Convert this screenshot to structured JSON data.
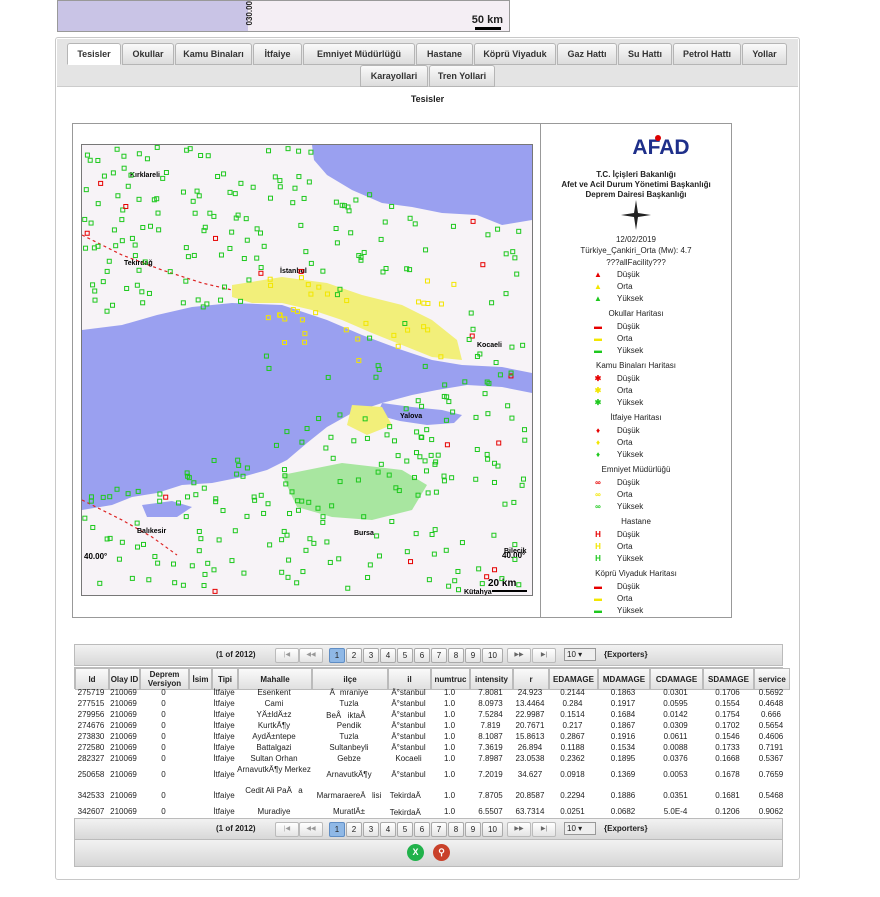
{
  "top_map": {
    "scale_label": "50 km",
    "side_label": "030.00"
  },
  "tabs": [
    {
      "label": "Tesisler"
    },
    {
      "label": "Okullar"
    },
    {
      "label": "Kamu Binaları"
    },
    {
      "label": "İtfaiye"
    },
    {
      "label": "Emniyet Müdürlüğü"
    },
    {
      "label": "Hastane"
    },
    {
      "label": "Köprü Viyaduk"
    },
    {
      "label": "Gaz Hattı"
    },
    {
      "label": "Su Hattı"
    },
    {
      "label": "Petrol Hattı"
    },
    {
      "label": "Yollar"
    },
    {
      "label": "Karayollari"
    },
    {
      "label": "Tren Yollari"
    }
  ],
  "section_title": "Tesisler",
  "map": {
    "city_labels": [
      "Kırklareli",
      "Tekirdağ",
      "İstanbul",
      "Kocaeli",
      "Yalova",
      "Balıkesir",
      "Bursa",
      "Bilecik",
      "Kütahya"
    ],
    "coord_label": "40.00°",
    "coord_label_right": "40.00°",
    "scale_label": "20 km"
  },
  "legend": {
    "logo": "AFAD",
    "org1": "T.C. İçişleri Bakanlığı",
    "org2": "Afet ve Acil Durum Yönetimi Başkanlığı",
    "org3": "Deprem Dairesi Başkanlığı",
    "date": "12/02/2019",
    "event": "Türkiye_Çankiri_Orta (Mw): 4.7",
    "subtitle": "???allFacility???",
    "groups": [
      {
        "title": "",
        "items": [
          "Düşük",
          "Orta",
          "Yüksek"
        ]
      },
      {
        "title": "Okullar Haritası",
        "items": [
          "Düşük",
          "Orta",
          "Yüksek"
        ]
      },
      {
        "title": "Kamu Binaları Haritası",
        "items": [
          "Düşük",
          "Orta",
          "Yüksek"
        ]
      },
      {
        "title": "İtfaiye Haritası",
        "items": [
          "Düşük",
          "Orta",
          "Yüksek"
        ]
      },
      {
        "title": "Emniyet Müdürlüğü",
        "items": [
          "Düşük",
          "Orta",
          "Yüksek"
        ]
      },
      {
        "title": "Hastane",
        "items": [
          "Düşük",
          "Orta",
          "Yüksek"
        ]
      },
      {
        "title": "Köprü Viyaduk Haritası",
        "items": [
          "Düşük",
          "Orta",
          "Yüksek"
        ]
      }
    ],
    "colors": {
      "low": "#e60000",
      "mid": "#f2e600",
      "high": "#1ec81e"
    }
  },
  "paginator": {
    "label": "(1 of 2012)",
    "pages": [
      "1",
      "2",
      "3",
      "4",
      "5",
      "6",
      "7",
      "8",
      "9",
      "10"
    ],
    "current": "1",
    "rows_per_page": "10",
    "exporters": "{Exporters}"
  },
  "table": {
    "columns": [
      "Id",
      "Olay ID",
      "Deprem Versiyon",
      "İsim",
      "Tipi",
      "Mahalle",
      "ilçe",
      "il",
      "numtruc",
      "intensity",
      "r",
      "EDAMAGE",
      "MDAMAGE",
      "CDAMAGE",
      "SDAMAGE",
      "service"
    ],
    "rows": [
      [
        "275719",
        "210069",
        "0",
        "",
        "İtfaiye",
        "Esenkent",
        "Ãmraniye",
        "Ä°stanbul",
        "1.0",
        "7.8081",
        "24.923",
        "0.2144",
        "0.1863",
        "0.0301",
        "0.1706",
        "0.5692"
      ],
      [
        "277515",
        "210069",
        "0",
        "",
        "İtfaiye",
        "Cami",
        "Tuzla",
        "Ä°stanbul",
        "1.0",
        "8.0973",
        "13.4464",
        "0.284",
        "0.1917",
        "0.0595",
        "0.1554",
        "0.4648"
      ],
      [
        "279956",
        "210069",
        "0",
        "",
        "İtfaiye",
        "YÄ±ldÄ±z",
        "BeÅiktaÅ",
        "Ä°stanbul",
        "1.0",
        "7.5284",
        "22.9987",
        "0.1514",
        "0.1684",
        "0.0142",
        "0.1754",
        "0.666"
      ],
      [
        "274676",
        "210069",
        "0",
        "",
        "İtfaiye",
        "KurtkÃ¶y",
        "Pendik",
        "Ä°stanbul",
        "1.0",
        "7.819",
        "20.7671",
        "0.217",
        "0.1867",
        "0.0309",
        "0.1702",
        "0.5654"
      ],
      [
        "273830",
        "210069",
        "0",
        "",
        "İtfaiye",
        "AydÄ±ntepe",
        "Tuzla",
        "Ä°stanbul",
        "1.0",
        "8.1087",
        "15.8613",
        "0.2867",
        "0.1916",
        "0.0611",
        "0.1546",
        "0.4606"
      ],
      [
        "272580",
        "210069",
        "0",
        "",
        "İtfaiye",
        "Battalgazi",
        "Sultanbeyli",
        "Ä°stanbul",
        "1.0",
        "7.3619",
        "26.894",
        "0.1188",
        "0.1534",
        "0.0088",
        "0.1733",
        "0.7191"
      ],
      [
        "282327",
        "210069",
        "0",
        "",
        "İtfaiye",
        "Sultan Orhan",
        "Gebze",
        "Kocaeli",
        "1.0",
        "7.8987",
        "23.0538",
        "0.2362",
        "0.1895",
        "0.0376",
        "0.1668",
        "0.5367"
      ],
      [
        "250658",
        "210069",
        "0",
        "",
        "İtfaiye",
        "ArnavutkÃ¶y Merkez",
        "ArnavutkÃ¶y",
        "Ä°stanbul",
        "1.0",
        "7.2019",
        "34.627",
        "0.0918",
        "0.1369",
        "0.0053",
        "0.1678",
        "0.7659"
      ],
      [
        "342533",
        "210069",
        "0",
        "",
        "İtfaiye",
        "Cedit Ali PaÅa",
        "MarmaraereÄlisi",
        "TekirdaÄ",
        "1.0",
        "7.8705",
        "20.8587",
        "0.2294",
        "0.1886",
        "0.0351",
        "0.1681",
        "0.5468"
      ],
      [
        "342607",
        "210069",
        "0",
        "",
        "İtfaiye",
        "Muradiye",
        "MuratlÄ±",
        "TekirdaÄ",
        "1.0",
        "6.5507",
        "63.7314",
        "0.0251",
        "0.0682",
        "5.0E-4",
        "0.1206",
        "0.9062"
      ]
    ]
  },
  "export": {
    "excel": "X"
  }
}
